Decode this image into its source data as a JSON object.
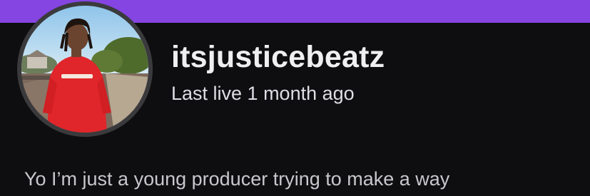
{
  "profile": {
    "username": "itsjusticebeatz",
    "status": "Last live 1 month ago",
    "bio": "Yo I’m just a young producer trying to make a way",
    "avatar_alt": "profile photo"
  },
  "colors": {
    "banner": "#8545e3",
    "background": "#0e0e10",
    "avatar_ring": "#3a3a3d",
    "username_text": "#efeff1",
    "secondary_text": "#dedee3"
  }
}
